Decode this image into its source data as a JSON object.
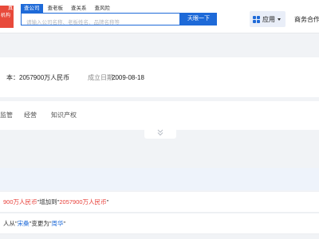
{
  "header": {
    "logo_line1": "真",
    "logo_line2": "机构",
    "search_tabs": [
      "查公司",
      "查老板",
      "查关系",
      "查风险"
    ],
    "search_placeholder": "请输入公司名称、老板姓名、品牌名称等",
    "search_button": "天眼一下",
    "apps_label": "应用",
    "business_link": "商务合作"
  },
  "company_info": {
    "registered_capital": "本：2057900万人民币",
    "established_label": "成立日期：",
    "established_date": "2009-08-18"
  },
  "nav_tabs": [
    "监管",
    "经营",
    "知识产权"
  ],
  "changes": [
    {
      "prefix": "900万人民币",
      "mid": "增加到",
      "value": "2057900万人民币"
    },
    {
      "prefix": "人从",
      "old_value": "宋桑",
      "mid": "变更为",
      "new_value": "周华"
    }
  ],
  "colors": {
    "brand_blue": "#1e6ad8",
    "logo_red": "#e84a3b",
    "highlight_red": "#e8403a"
  },
  "icons": [
    "grid-icon",
    "chevron-down-icon",
    "double-chevron-down-icon"
  ]
}
